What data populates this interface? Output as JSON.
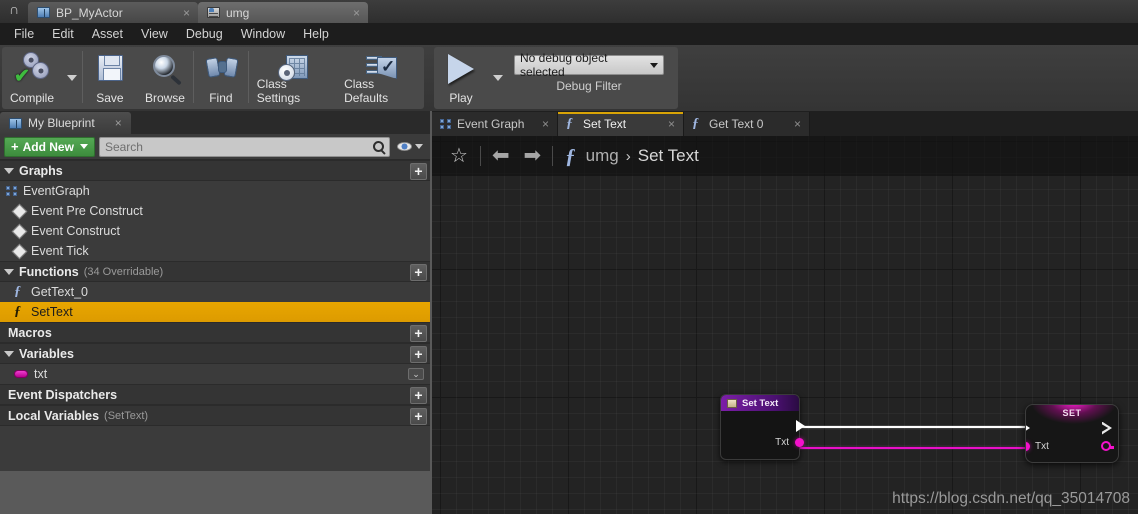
{
  "window": {
    "logo_icon": "unreal-engine-logo",
    "tabs": [
      {
        "label": "BP_MyActor",
        "icon": "blueprint-icon",
        "active": false,
        "close": "×"
      },
      {
        "label": "umg",
        "icon": "widget-icon",
        "active": true,
        "close": "×"
      }
    ]
  },
  "menubar": {
    "items": [
      "File",
      "Edit",
      "Asset",
      "View",
      "Debug",
      "Window",
      "Help"
    ]
  },
  "toolbar": {
    "compile": {
      "label": "Compile",
      "icon": "compile-gears-check-icon"
    },
    "save": {
      "label": "Save",
      "icon": "floppy-disk-icon"
    },
    "browse": {
      "label": "Browse",
      "icon": "magnifier-icon"
    },
    "find": {
      "label": "Find",
      "icon": "binoculars-icon"
    },
    "class_settings": {
      "label": "Class Settings",
      "icon": "class-settings-icon"
    },
    "class_defaults": {
      "label": "Class Defaults",
      "icon": "class-defaults-icon"
    },
    "play": {
      "label": "Play",
      "icon": "play-triangle-icon"
    },
    "debug_object": {
      "value": "No debug object selected",
      "caption": "Debug Filter"
    }
  },
  "my_blueprint": {
    "tab_label": "My Blueprint",
    "tab_icon": "blueprint-book-icon",
    "tab_close": "×",
    "add_new_label": "Add New",
    "search": {
      "value": "",
      "placeholder": "Search"
    },
    "sections": [
      {
        "title": "Graphs",
        "subtitle": "",
        "add": "+",
        "rows": [
          {
            "label": "EventGraph",
            "icon": "graph-icon",
            "indent": 0,
            "selected": false
          },
          {
            "label": "Event Pre Construct",
            "icon": "event-node-icon",
            "indent": 1,
            "selected": false
          },
          {
            "label": "Event Construct",
            "icon": "event-node-icon",
            "indent": 1,
            "selected": false
          },
          {
            "label": "Event Tick",
            "icon": "event-node-icon",
            "indent": 1,
            "selected": false
          }
        ]
      },
      {
        "title": "Functions",
        "subtitle": "(34 Overridable)",
        "add": "+",
        "rows": [
          {
            "label": "GetText_0",
            "icon": "function-icon",
            "indent": 1,
            "selected": false
          },
          {
            "label": "SetText",
            "icon": "function-icon",
            "indent": 1,
            "selected": true
          }
        ]
      },
      {
        "title": "Macros",
        "subtitle": "",
        "add": "+",
        "rows": []
      },
      {
        "title": "Variables",
        "subtitle": "",
        "add": "+",
        "rows": [
          {
            "label": "txt",
            "icon": "text-variable-icon",
            "indent": 1,
            "selected": false,
            "end_icon": "visibility-toggle"
          }
        ]
      },
      {
        "title": "Event Dispatchers",
        "subtitle": "",
        "add": "+",
        "rows": []
      },
      {
        "title": "Local Variables",
        "subtitle": "(SetText)",
        "add": "+",
        "rows": []
      }
    ]
  },
  "graph": {
    "tabs": [
      {
        "label": "Event Graph",
        "icon": "graph-icon",
        "active": false,
        "close": "×"
      },
      {
        "label": "Set Text",
        "icon": "function-icon",
        "active": true,
        "close": "×"
      },
      {
        "label": "Get Text 0",
        "icon": "function-icon",
        "active": false,
        "close": "×"
      }
    ],
    "breadcrumb": {
      "star_icon": "☆",
      "back_icon": "⬅",
      "forward_icon": "➡",
      "fn_icon": "f",
      "root": "umg",
      "separator": "›",
      "current": "Set Text"
    },
    "nodes": [
      {
        "id": "set-text-entry",
        "type": "function-entry",
        "title": "Set Text",
        "header_icon": "function-entry-icon",
        "pins_out": [
          {
            "name": "",
            "kind": "exec"
          },
          {
            "name": "Txt",
            "kind": "text"
          }
        ]
      },
      {
        "id": "set-node",
        "type": "variable-set",
        "title": "SET",
        "pins_in": [
          {
            "name": "",
            "kind": "exec"
          },
          {
            "name": "Txt",
            "kind": "text"
          }
        ],
        "pins_out": [
          {
            "name": "",
            "kind": "exec"
          },
          {
            "name": "",
            "kind": "text"
          }
        ]
      }
    ],
    "wires": [
      {
        "from": "set-text-entry.exec",
        "to": "set-node.exec",
        "color": "#ffffff"
      },
      {
        "from": "set-text-entry.Txt",
        "to": "set-node.Txt",
        "color": "#e810c8"
      }
    ],
    "watermark": "https://blog.csdn.net/qq_35014708"
  },
  "colors": {
    "selection_amber": "#e8a600",
    "active_tab_underline": "#d9a406",
    "text_pin_magenta": "#f411cb",
    "exec_wire": "#ffffff",
    "add_new_green": "#3d8c3d",
    "node_header_purple": "#6d1a96"
  }
}
